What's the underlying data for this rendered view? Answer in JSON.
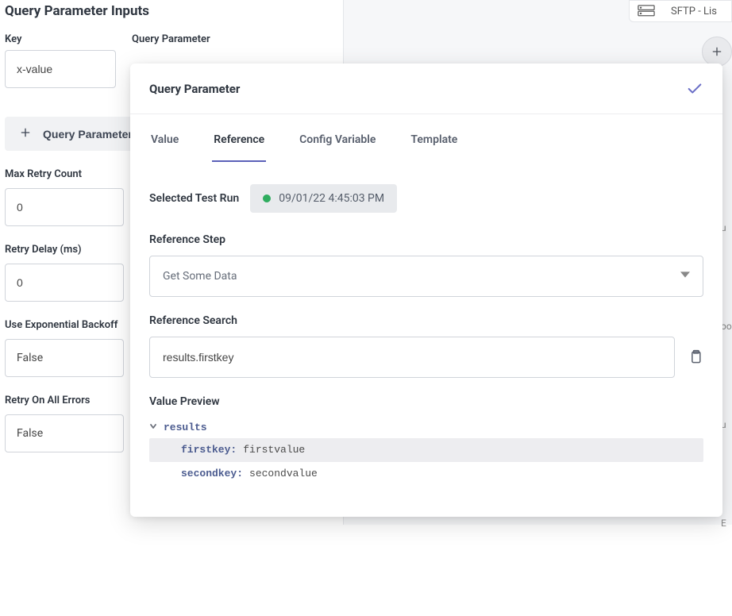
{
  "leftPanel": {
    "title": "Query Parameter Inputs",
    "keyLabel": "Key",
    "queryParamLabel": "Query Parameter",
    "keyValue": "x-value",
    "addButtonLabel": "Query Parameter",
    "maxRetry": {
      "label": "Max Retry Count",
      "value": "0"
    },
    "retryDelay": {
      "label": "Retry Delay (ms)",
      "value": "0"
    },
    "expBackoff": {
      "label": "Use Exponential Backoff",
      "value": "False"
    },
    "retryAll": {
      "label": "Retry On All Errors",
      "value": "False"
    }
  },
  "canvas": {
    "nodeLabel": "SFTP - Lis"
  },
  "modal": {
    "title": "Query Parameter",
    "tabs": {
      "value": "Value",
      "reference": "Reference",
      "config": "Config Variable",
      "template": "Template",
      "activeIndex": 1
    },
    "selectedRunLabel": "Selected Test Run",
    "selectedRunText": "09/01/22 4:45:03 PM",
    "refStepLabel": "Reference Step",
    "refStepValue": "Get Some Data",
    "refSearchLabel": "Reference Search",
    "refSearchValue": "results.firstkey",
    "previewLabel": "Value Preview",
    "preview": {
      "root": "results",
      "rows": [
        {
          "key": "firstkey:",
          "value": "firstvalue",
          "highlight": true
        },
        {
          "key": "secondkey:",
          "value": "secondvalue",
          "highlight": false
        }
      ]
    }
  },
  "peek": {
    "a": "u",
    "b": "oo",
    "c": "u",
    "d": "E"
  }
}
